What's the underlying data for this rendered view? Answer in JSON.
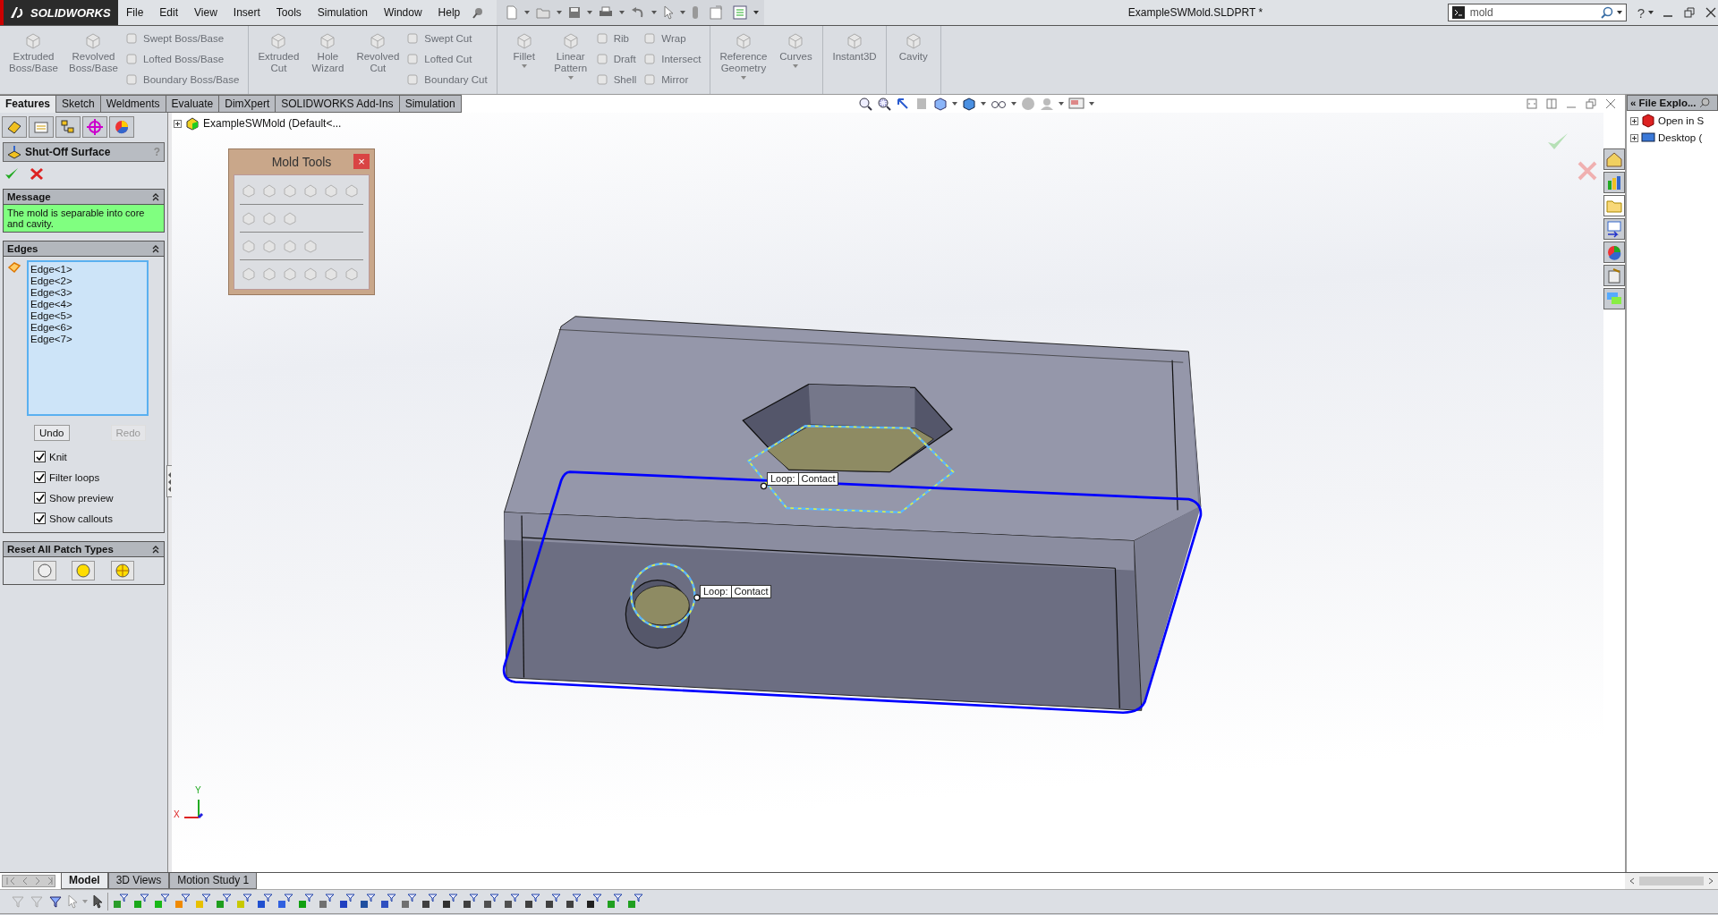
{
  "app": {
    "logo": "SOLIDWORKS"
  },
  "menu": [
    {
      "label": "File"
    },
    {
      "label": "Edit"
    },
    {
      "label": "View"
    },
    {
      "label": "Insert"
    },
    {
      "label": "Tools"
    },
    {
      "label": "Simulation"
    },
    {
      "label": "Window"
    },
    {
      "label": "Help"
    }
  ],
  "title": "ExampleSWMold.SLDPRT *",
  "search": {
    "value": "mold"
  },
  "help": "?",
  "ribbon": [
    {
      "large": [
        {
          "label": "Extruded\nBoss/Base",
          "dropdown": false
        },
        {
          "label": "Revolved\nBoss/Base",
          "dropdown": false
        }
      ],
      "small": [
        [
          "Swept Boss/Base",
          "Lofted Boss/Base",
          "Boundary Boss/Base"
        ]
      ]
    },
    {
      "large": [
        {
          "label": "Extruded\nCut",
          "dropdown": false
        },
        {
          "label": "Hole\nWizard",
          "dropdown": false
        },
        {
          "label": "Revolved\nCut",
          "dropdown": false
        }
      ],
      "small": [
        [
          "Swept Cut",
          "Lofted Cut",
          "Boundary Cut"
        ]
      ]
    },
    {
      "large": [
        {
          "label": "Fillet",
          "dropdown": true
        },
        {
          "label": "Linear\nPattern",
          "dropdown": true
        }
      ],
      "small": [
        [
          "Rib",
          "Draft",
          "Shell"
        ],
        [
          "Wrap",
          "Intersect",
          "Mirror"
        ]
      ]
    },
    {
      "large": [
        {
          "label": "Reference\nGeometry",
          "dropdown": true
        },
        {
          "label": "Curves",
          "dropdown": true
        }
      ]
    },
    {
      "large": [
        {
          "label": "Instant3D",
          "dropdown": false
        }
      ]
    },
    {
      "large": [
        {
          "label": "Cavity",
          "dropdown": false
        }
      ]
    }
  ],
  "command_tabs": [
    {
      "label": "Features",
      "selected": true
    },
    {
      "label": "Sketch",
      "selected": false
    },
    {
      "label": "Weldments",
      "selected": false
    },
    {
      "label": "Evaluate",
      "selected": false
    },
    {
      "label": "DimXpert",
      "selected": false
    },
    {
      "label": "SOLIDWORKS Add-Ins",
      "selected": false
    },
    {
      "label": "Simulation",
      "selected": false
    }
  ],
  "panel": {
    "title": "Shut-Off Surface",
    "help": "?",
    "message": {
      "title": "Message",
      "text": "The mold is separable into core and cavity."
    },
    "edges": {
      "title": "Edges",
      "items": [
        "Edge<1>",
        "Edge<2>",
        "Edge<3>",
        "Edge<4>",
        "Edge<5>",
        "Edge<6>",
        "Edge<7>"
      ],
      "buttons": [
        {
          "label": "Undo",
          "disabled": false
        },
        {
          "label": "Redo",
          "disabled": true
        }
      ]
    },
    "options": [
      {
        "label": "Knit",
        "checked": true
      },
      {
        "label": "Filter loops",
        "checked": true
      },
      {
        "label": "Show preview",
        "checked": true
      },
      {
        "label": "Show callouts",
        "checked": true
      }
    ],
    "patch": {
      "title": "Reset All Patch Types"
    }
  },
  "feature_tree": {
    "label": "ExampleSWMold  (Default<..."
  },
  "mold_tools": {
    "title": "Mold Tools",
    "close": "×"
  },
  "callouts": [
    {
      "label": "Loop:",
      "value": "Contact"
    },
    {
      "label": "Loop:",
      "value": "Contact"
    }
  ],
  "triad": {
    "x": "X",
    "y": "Y"
  },
  "task_pane": {
    "title": "« File Explo...",
    "items": [
      {
        "label": "Open in S"
      },
      {
        "label": "Desktop ("
      }
    ]
  },
  "bottom_tabs": [
    {
      "label": "Model",
      "selected": true
    },
    {
      "label": "3D Views",
      "selected": false
    },
    {
      "label": "Motion Study 1",
      "selected": false
    }
  ]
}
